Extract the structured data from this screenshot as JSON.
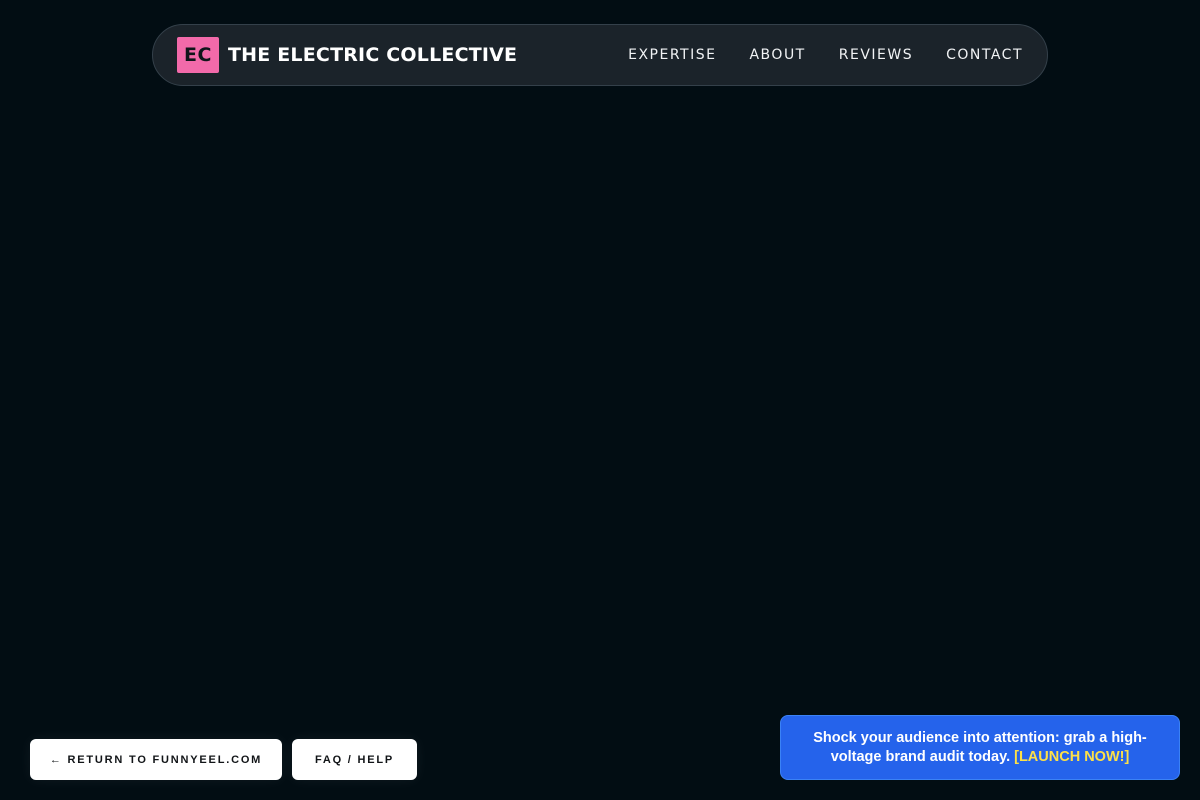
{
  "header": {
    "brand_badge": "EC",
    "brand_name": "THE ELECTRIC COLLECTIVE",
    "nav": [
      {
        "label": "EXPERTISE"
      },
      {
        "label": "ABOUT"
      },
      {
        "label": "REVIEWS"
      },
      {
        "label": "CONTACT"
      }
    ]
  },
  "footer": {
    "return_label": "← RETURN TO FUNNYEEL.COM",
    "faq_label": "FAQ / HELP"
  },
  "promo": {
    "message": "Shock your audience into attention: grab a high-voltage brand audit today.",
    "cta": "[LAUNCH NOW!]"
  },
  "colors": {
    "background": "#020d13",
    "navbar": "#1b232a",
    "brand_accent": "#f26aaa",
    "promo_bg": "#2563eb",
    "promo_cta": "#fde047"
  }
}
